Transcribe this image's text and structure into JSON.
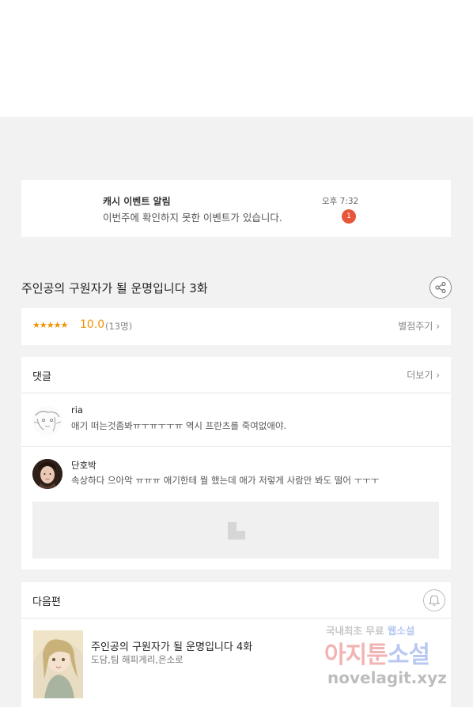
{
  "notification": {
    "title": "캐시 이벤트 알림",
    "message": "이번주에 확인하지 못한 이벤트가 있습니다.",
    "time": "오후 7:32",
    "badge": "1"
  },
  "episode": {
    "title": "주인공의 구원자가 될 운명입니다 3화"
  },
  "rating": {
    "stars": "★★★★★",
    "score": "10.0",
    "count": "(13명)",
    "rate_link": "별점주기 ›"
  },
  "comments": {
    "header": "댓글",
    "more_link": "더보기 ›",
    "items": [
      {
        "name": "ria",
        "text": "애기 떠는것좀봐ㅠㅜㅠㅜㅜㅠ 역시 프란츠를 죽여없애야."
      },
      {
        "name": "단호박",
        "text": "속상하다 으아악 ㅠㅠㅠ 애기한테 뭘 했는데 애가 저렇게 사람만 봐도 떨어 ㅜㅜㅜ"
      }
    ]
  },
  "next": {
    "header": "다음편",
    "title": "주인공의 구원자가 될 운명입니다 4화",
    "authors": "도담,팀 해피게리,은소로"
  },
  "watermark": {
    "line1_a": "국내최초 무료 ",
    "line1_b": "웹소설",
    "main_a": "아지툰",
    "main_b": "소설",
    "url": "novelagit.xyz"
  },
  "icons": {
    "share": "share-icon",
    "bell": "bell-icon",
    "ad": "ad-placeholder-icon"
  },
  "colors": {
    "accent": "#f29100",
    "badge": "#e8563a",
    "background": "#f2f2f2"
  }
}
